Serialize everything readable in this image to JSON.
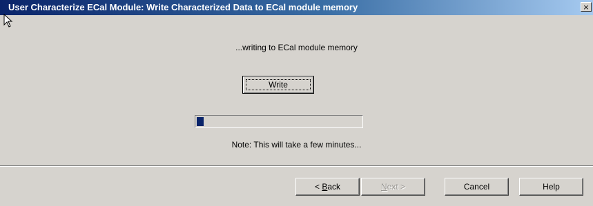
{
  "window": {
    "title": "User Characterize ECal Module: Write Characterized Data to ECal module memory",
    "close_glyph": "×"
  },
  "main": {
    "status_text": "...writing to ECal module memory",
    "write_button": "Write",
    "progress_fraction": 0.06,
    "note": "Note:  This will take a few minutes..."
  },
  "footer": {
    "back_prefix": "< ",
    "back_key": "B",
    "back_rest": "ack",
    "next_key": "N",
    "next_rest": "ext >",
    "cancel_label": "Cancel",
    "help_label": "Help"
  },
  "icons": {
    "cursor": "arrow-cursor-icon",
    "close": "close-icon"
  },
  "colors": {
    "title_gradient_start": "#0a246a",
    "title_gradient_end": "#a6caf0",
    "dialog_face": "#d6d3ce",
    "progress_fill": "#0a246a"
  }
}
